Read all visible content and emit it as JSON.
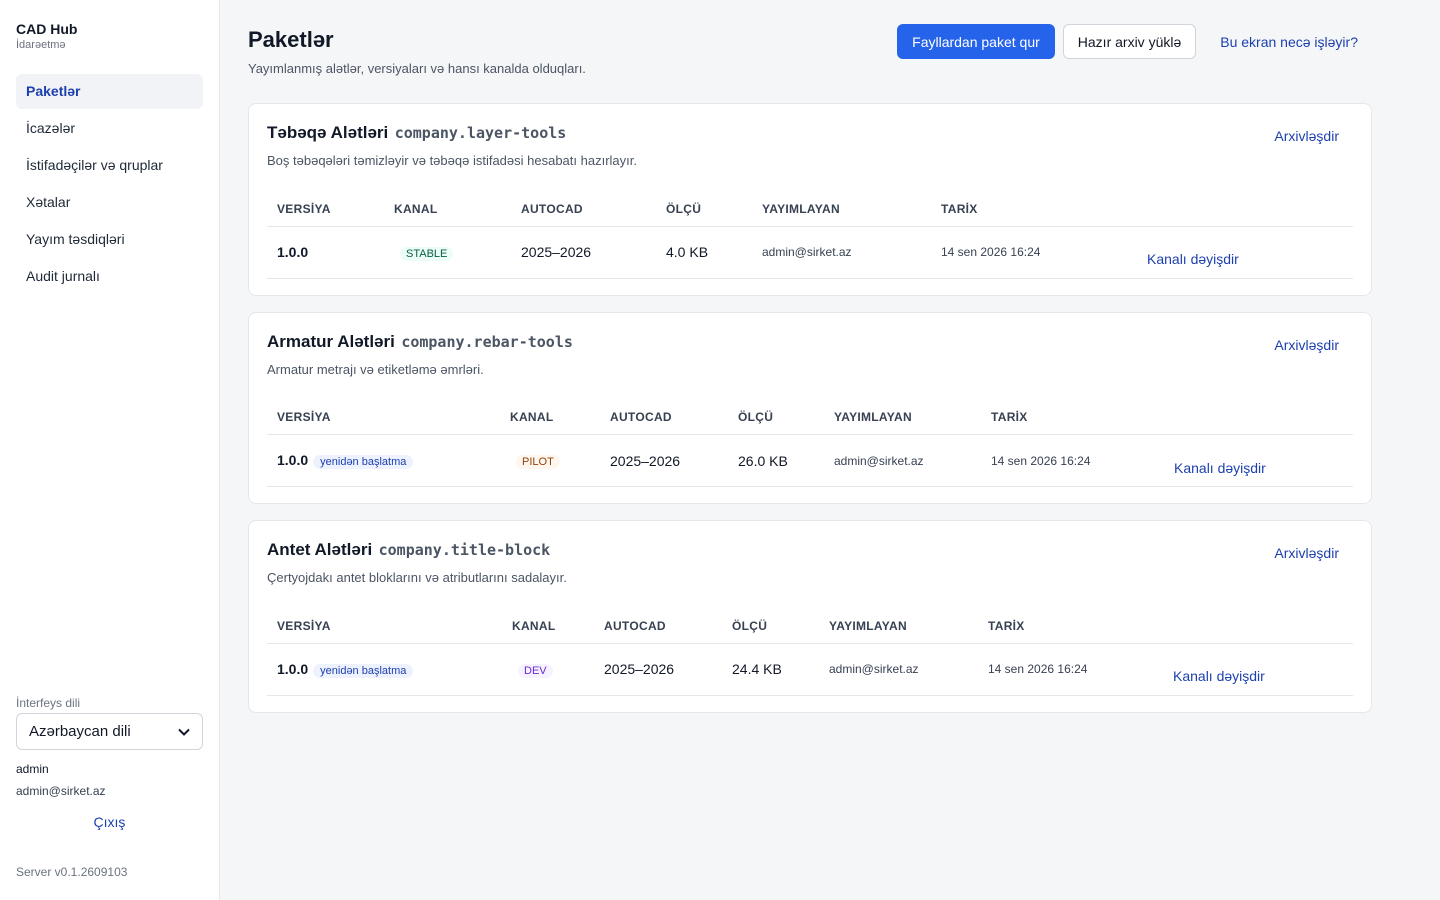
{
  "sidebar": {
    "brand_title": "CAD Hub",
    "brand_sub": "İdarəetmə",
    "items": [
      {
        "label": "Paketlər"
      },
      {
        "label": "İcazələr"
      },
      {
        "label": "İstifadəçilər və qruplar"
      },
      {
        "label": "Xətalar"
      },
      {
        "label": "Yayım təsdiqləri"
      },
      {
        "label": "Audit jurnalı"
      }
    ],
    "lang_label": "İnterfeys dili",
    "lang_value": "Azərbaycan dili",
    "user_name": "admin",
    "user_email": "admin@sirket.az",
    "logout": "Çıxış",
    "server_version": "Server v0.1.2609103"
  },
  "header": {
    "title": "Paketlər",
    "subtitle": "Yayımlanmış alətlər, versiyaları və hansı kanalda olduqları.",
    "btn_build": "Fayllardan paket qur",
    "btn_upload": "Hazır arxiv yüklə",
    "help_link": "Bu ekran necə işləyir?"
  },
  "columns": {
    "version": "VERSİYA",
    "channel": "KANAL",
    "autocad": "AUTOCAD",
    "size": "ÖLÇÜ",
    "publisher": "YAYIMLAYAN",
    "date": "TARİX"
  },
  "packages": [
    {
      "name": "Təbəqə Alətləri",
      "id": "company.layer-tools",
      "description": "Boş təbəqələri təmizləyir və təbəqə istifadəsi hesabatı hazırlayır.",
      "archive": "Arxivləşdir",
      "row": {
        "version": "1.0.0",
        "restart": "",
        "channel": "STABLE",
        "autocad": "2025–2026",
        "size": "4.0 KB",
        "publisher": "admin@sirket.az",
        "date": "14 sen 2026 16:24",
        "action": "Kanalı dəyişdir"
      }
    },
    {
      "name": "Armatur Alətləri",
      "id": "company.rebar-tools",
      "description": "Armatur metrajı və etiketləmə əmrləri.",
      "archive": "Arxivləşdir",
      "row": {
        "version": "1.0.0",
        "restart": "yenidən başlatma",
        "channel": "PILOT",
        "autocad": "2025–2026",
        "size": "26.0 KB",
        "publisher": "admin@sirket.az",
        "date": "14 sen 2026 16:24",
        "action": "Kanalı dəyişdir"
      }
    },
    {
      "name": "Antet Alətləri",
      "id": "company.title-block",
      "description": "Çertyojdakı antet bloklarını və atributlarını sadalayır.",
      "archive": "Arxivləşdir",
      "row": {
        "version": "1.0.0",
        "restart": "yenidən başlatma",
        "channel": "DEV",
        "autocad": "2025–2026",
        "size": "24.4 KB",
        "publisher": "admin@sirket.az",
        "date": "14 sen 2026 16:24",
        "action": "Kanalı dəyişdir"
      }
    }
  ],
  "colors": {
    "accent": "#2563eb",
    "link": "#1e40af"
  }
}
